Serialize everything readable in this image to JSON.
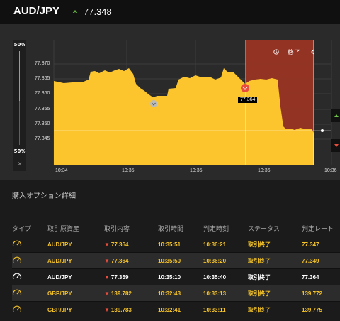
{
  "header": {
    "pair": "AUD/JPY",
    "rate": "77.348"
  },
  "chart": {
    "y_max_pct": "50%",
    "y_min_pct": "50%",
    "close_label": "×",
    "y_ticks": [
      "77.370",
      "77.365",
      "77.360",
      "77.355",
      "77.350",
      "77.345"
    ],
    "x_ticks": [
      "10:34",
      "10:35",
      "10:35",
      "10:36",
      "10:36"
    ],
    "end_label": "終了",
    "end_icon": "clock-icon",
    "entry_price": "77.364",
    "colors": {
      "area": "#fcc52d",
      "expired_zone": "#9b3423",
      "up": "#6ec046",
      "down": "#e74c3c"
    }
  },
  "section": {
    "title": "購入オプション詳細"
  },
  "table": {
    "headers": [
      "タイプ",
      "取引原資産",
      "取引内容",
      "取引時間",
      "判定時刻",
      "ステータス",
      "判定レート"
    ],
    "rows": [
      {
        "icon": "gauge-icon",
        "asset": "AUD/JPY",
        "content": "77.364",
        "time": "10:35:51",
        "judge": "10:36:21",
        "status": "取引終了",
        "rate": "77.347",
        "tone": "yel"
      },
      {
        "icon": "gauge-icon",
        "asset": "AUD/JPY",
        "content": "77.364",
        "time": "10:35:50",
        "judge": "10:36:20",
        "status": "取引終了",
        "rate": "77.349",
        "tone": "yel"
      },
      {
        "icon": "gauge-icon",
        "asset": "AUD/JPY",
        "content": "77.359",
        "time": "10:35:10",
        "judge": "10:35:40",
        "status": "取引終了",
        "rate": "77.364",
        "tone": "wht"
      },
      {
        "icon": "gauge-icon",
        "asset": "GBP/JPY",
        "content": "139.782",
        "time": "10:32:43",
        "judge": "10:33:13",
        "status": "取引終了",
        "rate": "139.772",
        "tone": "yel"
      },
      {
        "icon": "gauge-icon",
        "asset": "GBP/JPY",
        "content": "139.783",
        "time": "10:32:41",
        "judge": "10:33:11",
        "status": "取引終了",
        "rate": "139.775",
        "tone": "yel"
      }
    ]
  }
}
